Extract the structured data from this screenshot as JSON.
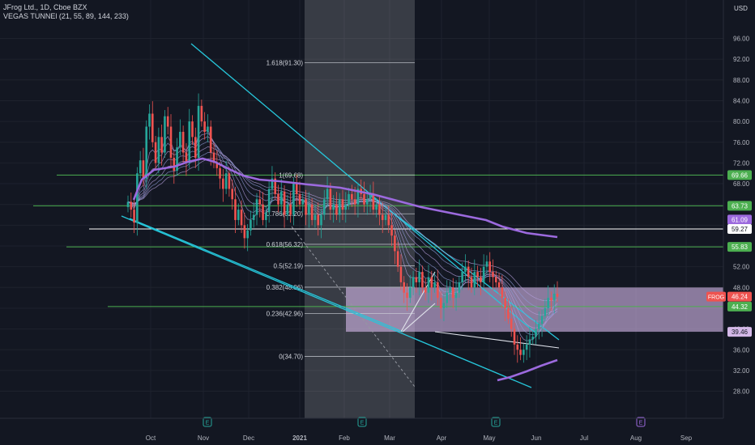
{
  "header": {
    "symbol_line": "JFrog Ltd., 1D, Cboe BZX",
    "indicator_line": "VEGAS TUNNEl (21, 55, 89, 144, 233)",
    "currency": "USD"
  },
  "chart_data": {
    "type": "candlestick",
    "ticker": "FROG",
    "x_tick_labels": [
      "Oct",
      "Nov",
      "Dec",
      "2021",
      "Feb",
      "Mar",
      "Apr",
      "May",
      "Jun",
      "Jul",
      "Aug",
      "Sep"
    ],
    "y_tick_labels": [
      "96.00",
      "92.00",
      "88.00",
      "84.00",
      "80.00",
      "76.00",
      "72.00",
      "68.00",
      "64.00",
      "60.00",
      "56.00",
      "52.00",
      "48.00",
      "44.00",
      "40.00",
      "36.00",
      "32.00",
      "28.00"
    ],
    "ylim": [
      26.5,
      99
    ],
    "price_labels": [
      {
        "label": "69.66",
        "value": 69.66,
        "color": "#4caf50"
      },
      {
        "label": "63.73",
        "value": 63.73,
        "color": "#4caf50"
      },
      {
        "label": "61.09",
        "value": 61.09,
        "color": "#9c6ade"
      },
      {
        "label": "59.27",
        "value": 59.27,
        "color": "#ffffff"
      },
      {
        "label": "55.83",
        "value": 55.83,
        "color": "#4caf50"
      },
      {
        "label": "46.24",
        "value": 46.24,
        "color": "#ef5350"
      },
      {
        "label": "44.32",
        "value": 44.32,
        "color": "#4caf50"
      },
      {
        "label": "39.46",
        "value": 39.46,
        "color": "#d4b8e8"
      }
    ],
    "ticker_tag": "FROG",
    "fib_levels": [
      {
        "label": "1.618(91.30)",
        "value": 91.3
      },
      {
        "label": "1(69.68)",
        "value": 69.68
      },
      {
        "label": "0.786(62.20)",
        "value": 62.2
      },
      {
        "label": "0.618(56.32)",
        "value": 56.32
      },
      {
        "label": "0.5(52.19)",
        "value": 52.19
      },
      {
        "label": "0.382(48.06)",
        "value": 48.06
      },
      {
        "label": "0.236(42.96)",
        "value": 42.96
      },
      {
        "label": "0(34.70)",
        "value": 34.7
      }
    ],
    "zone": {
      "top": 48.0,
      "bottom": 39.46
    },
    "closes": [
      64.5,
      63,
      60.5,
      70,
      72.5,
      69,
      79,
      81.5,
      76,
      72,
      77,
      74,
      81,
      79,
      73,
      70.5,
      75,
      78,
      74,
      72,
      80,
      77,
      73,
      83,
      80,
      78,
      79,
      74,
      72,
      71,
      69,
      67,
      70,
      67,
      65,
      61,
      63,
      60,
      57.5,
      59,
      61,
      62,
      65,
      64,
      61,
      62.5,
      67,
      69,
      66,
      64,
      66.5,
      62,
      64,
      62,
      68,
      66,
      64,
      65,
      62,
      64,
      61,
      62,
      60,
      62,
      65,
      67,
      63,
      64,
      62,
      65,
      63,
      64,
      66,
      65,
      64,
      67,
      66,
      64,
      65,
      66,
      63,
      64,
      62,
      61,
      62,
      60,
      58,
      55,
      52,
      49,
      47,
      46,
      48,
      50,
      49,
      51,
      48,
      47,
      50,
      48,
      49,
      46,
      44,
      45,
      47,
      48,
      46,
      47,
      49,
      51,
      52,
      50,
      48,
      51,
      50,
      49,
      52,
      53,
      51,
      50,
      49,
      48,
      46,
      44,
      42,
      40,
      37,
      36,
      35,
      36,
      37,
      38,
      38.5,
      40,
      41,
      42.5,
      44,
      46,
      45.5,
      46.8,
      46.2
    ]
  }
}
